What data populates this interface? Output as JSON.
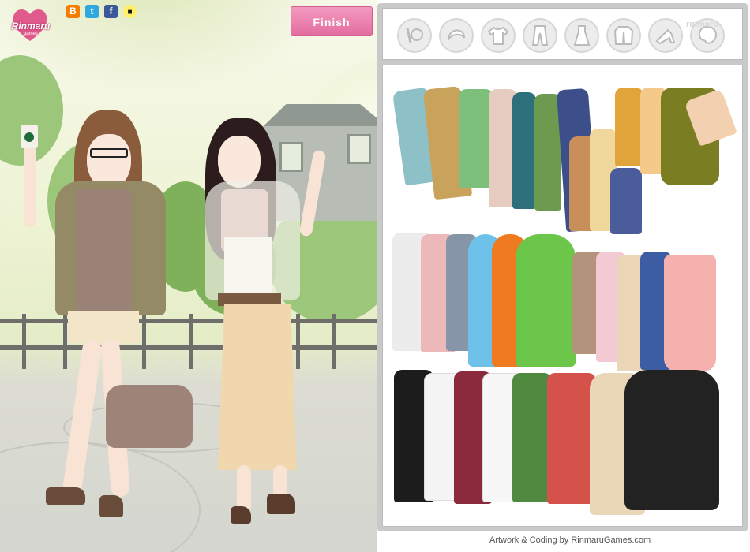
{
  "logo": {
    "brand": "Rinmaru",
    "sub": "games"
  },
  "social": [
    {
      "name": "blogger",
      "glyph": "B",
      "color": "#f57d00"
    },
    {
      "name": "twitter",
      "glyph": "t",
      "color": "#2fa7df"
    },
    {
      "name": "facebook",
      "glyph": "f",
      "color": "#3b5998"
    },
    {
      "name": "stop",
      "glyph": "■",
      "color": "#111111"
    }
  ],
  "finish_label": "Finish",
  "toolbar": {
    "tabs": [
      "accessories",
      "hair",
      "tops",
      "pants",
      "dresses",
      "jackets",
      "shoes",
      "backgrounds"
    ],
    "watermark": "rinmaru"
  },
  "credit": "Artwork & Coding by RinmaruGames.com",
  "colors": {
    "accent": "#e36c9f",
    "panel": "#c9c9c9"
  }
}
